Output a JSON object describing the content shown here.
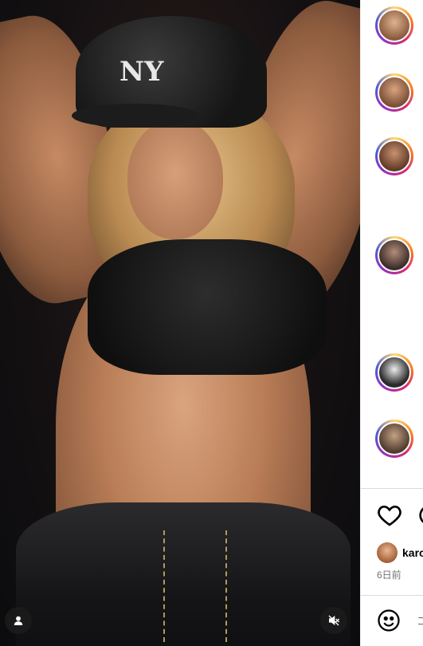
{
  "media": {
    "cap_logo": "NY",
    "user_button_icon": "user-icon",
    "mute_button_icon": "speaker-muted-icon"
  },
  "sidebar": {
    "avatars": [
      {
        "name": "avatar-1",
        "icon": "avatar"
      },
      {
        "name": "avatar-2",
        "icon": "avatar"
      },
      {
        "name": "avatar-3",
        "icon": "avatar"
      },
      {
        "name": "avatar-4",
        "icon": "avatar"
      },
      {
        "name": "avatar-5",
        "icon": "avatar"
      },
      {
        "name": "avatar-6",
        "icon": "avatar"
      }
    ]
  },
  "post": {
    "owner_name": "karo",
    "time_ago": "6日前",
    "comment_placeholder": "コ"
  },
  "colors": {
    "accent_ring": "#d62976",
    "time_text": "#737373"
  }
}
